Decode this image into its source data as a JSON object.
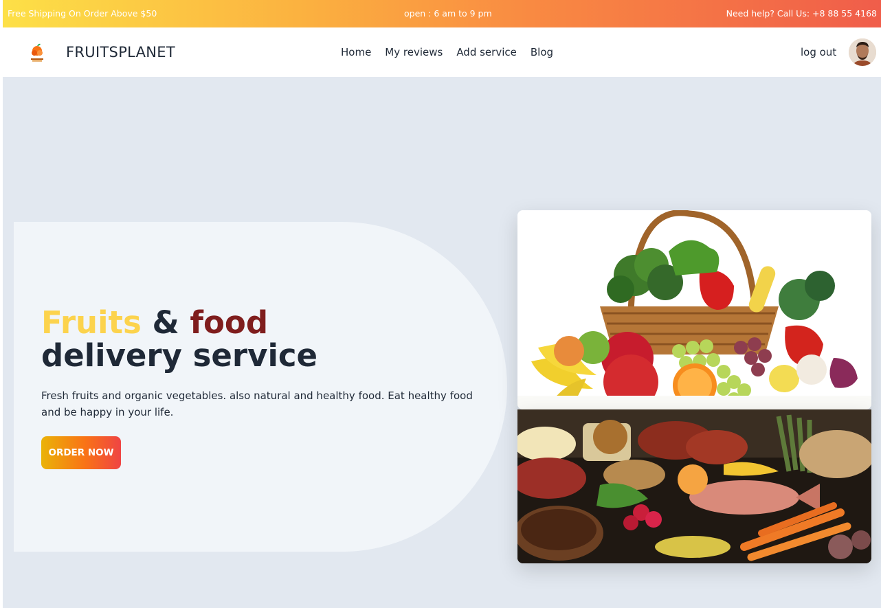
{
  "topbar": {
    "left_text": "Free Shipping On Order Above $50",
    "center_text": "open : 6 am to 9 pm",
    "right_text": "Need help? Call Us: +8 88 55 4168"
  },
  "nav": {
    "brand": "FRUITSPLANET",
    "links": [
      "Home",
      "My reviews",
      "Add service",
      "Blog"
    ],
    "logout": "log out"
  },
  "hero": {
    "title_word1": "Fruits",
    "title_amp": "&",
    "title_word2": "food",
    "title_line2": "delivery service",
    "description": "Fresh fruits and organic vegetables. also natural and healthy food. Eat healthy food and be happy in your life.",
    "button_label": "ORDER NOW"
  },
  "colors": {
    "accent_yellow": "#fcd34d",
    "accent_maroon": "#7f1d1d",
    "background": "#e2e8f0"
  }
}
